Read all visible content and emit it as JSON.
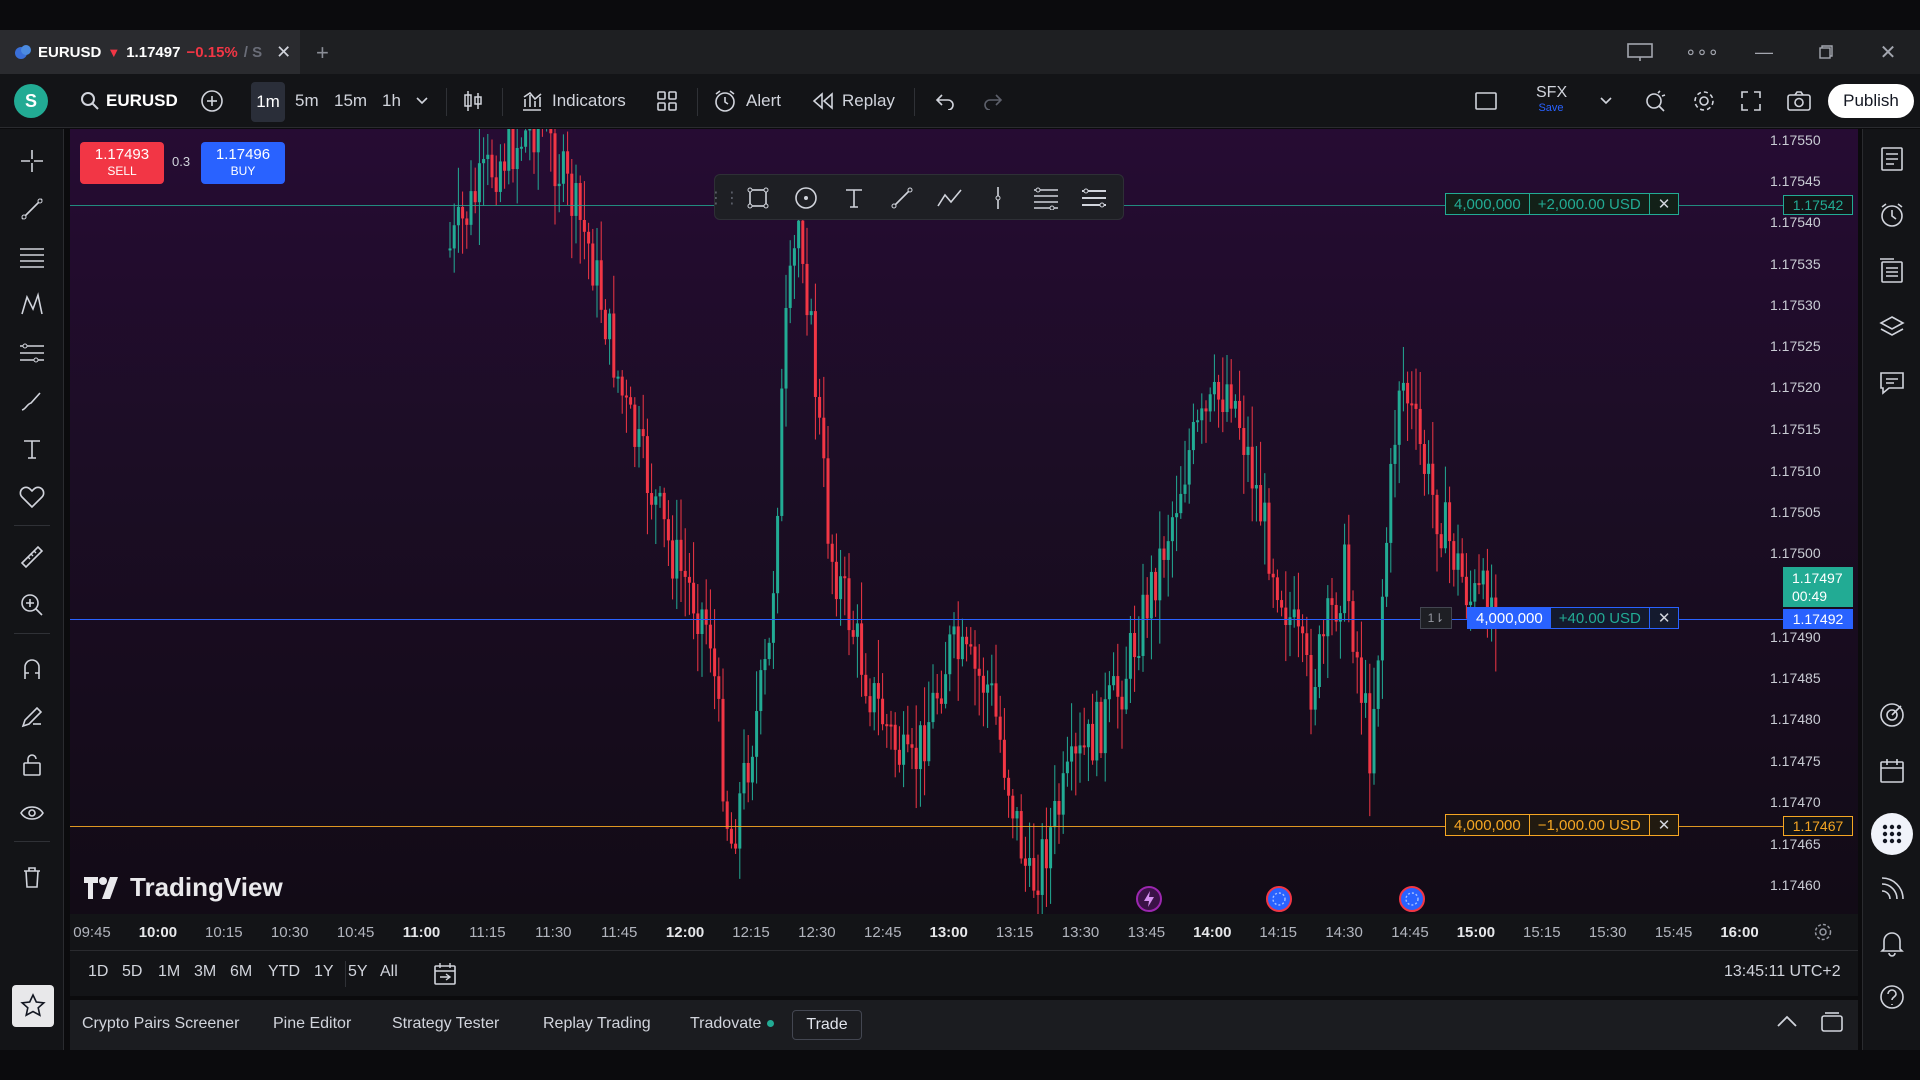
{
  "window": {
    "tab_symbol": "EURUSD",
    "tab_arrow": "▼",
    "tab_price": "1.17497",
    "tab_change": "−0.15%",
    "tab_fade": "/ S"
  },
  "toolbar": {
    "avatar_letter": "S",
    "symbol": "EURUSD",
    "timeframes": [
      "1m",
      "5m",
      "15m",
      "1h"
    ],
    "indicators": "Indicators",
    "alert": "Alert",
    "replay": "Replay",
    "layout_name": "SFX",
    "layout_save": "Save",
    "publish": "Publish"
  },
  "trade": {
    "sell_price": "1.17493",
    "sell_label": "SELL",
    "spread": "0.3",
    "buy_price": "1.17496",
    "buy_label": "BUY"
  },
  "orders": {
    "tp": {
      "qty": "4,000,000",
      "pnl": "+2,000.00 USD",
      "price": "1.17542",
      "close": "✕"
    },
    "pos": {
      "qty": "4,000,000",
      "pnl": "+40.00 USD",
      "price": "1.17492",
      "close": "✕",
      "icon_label": "1⇂"
    },
    "sl": {
      "qty": "4,000,000",
      "pnl": "−1,000.00 USD",
      "price": "1.17467",
      "close": "✕"
    }
  },
  "last_price": {
    "price": "1.17497",
    "countdown": "00:49"
  },
  "price_scale": [
    "1.17550",
    "1.17545",
    "1.17540",
    "1.17535",
    "1.17530",
    "1.17525",
    "1.17520",
    "1.17515",
    "1.17510",
    "1.17505",
    "1.17500",
    "1.17490",
    "1.17485",
    "1.17480",
    "1.17475",
    "1.17470",
    "1.17465",
    "1.17460"
  ],
  "time_axis": [
    {
      "t": "09:45",
      "bold": false
    },
    {
      "t": "10:00",
      "bold": true
    },
    {
      "t": "10:15",
      "bold": false
    },
    {
      "t": "10:30",
      "bold": false
    },
    {
      "t": "10:45",
      "bold": false
    },
    {
      "t": "11:00",
      "bold": true
    },
    {
      "t": "11:15",
      "bold": false
    },
    {
      "t": "11:30",
      "bold": false
    },
    {
      "t": "11:45",
      "bold": false
    },
    {
      "t": "12:00",
      "bold": true
    },
    {
      "t": "12:15",
      "bold": false
    },
    {
      "t": "12:30",
      "bold": false
    },
    {
      "t": "12:45",
      "bold": false
    },
    {
      "t": "13:00",
      "bold": true
    },
    {
      "t": "13:15",
      "bold": false
    },
    {
      "t": "13:30",
      "bold": false
    },
    {
      "t": "13:45",
      "bold": false
    },
    {
      "t": "14:00",
      "bold": true
    },
    {
      "t": "14:15",
      "bold": false
    },
    {
      "t": "14:30",
      "bold": false
    },
    {
      "t": "14:45",
      "bold": false
    },
    {
      "t": "15:00",
      "bold": true
    },
    {
      "t": "15:15",
      "bold": false
    },
    {
      "t": "15:30",
      "bold": false
    },
    {
      "t": "15:45",
      "bold": false
    },
    {
      "t": "16:00",
      "bold": true
    }
  ],
  "ranges": [
    "1D",
    "5D",
    "1M",
    "3M",
    "6M",
    "YTD",
    "1Y",
    "5Y",
    "All"
  ],
  "clock": "13:45:11 UTC+2",
  "bottom_tabs": [
    "Crypto Pairs Screener",
    "Pine Editor",
    "Strategy Tester",
    "Replay Trading",
    "Tradovate"
  ],
  "trade_tab": "Trade",
  "brand": "TradingView",
  "colors": {
    "up": "#22ab94",
    "down": "#f23645",
    "tp_line": "#22ab94",
    "pos_line": "#2962ff",
    "sl_line": "#f5a623",
    "accent": "#2962ff"
  }
}
